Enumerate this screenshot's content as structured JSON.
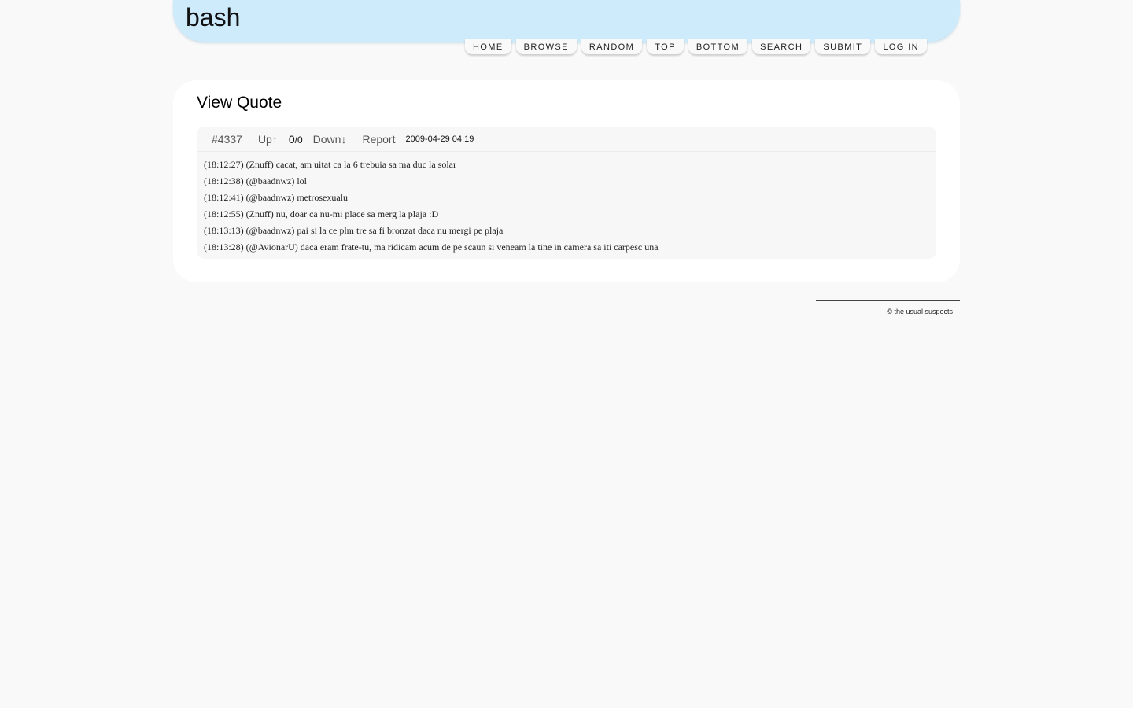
{
  "site": {
    "title": "bash"
  },
  "nav": [
    {
      "label": "Home"
    },
    {
      "label": "Browse"
    },
    {
      "label": "Random"
    },
    {
      "label": "Top"
    },
    {
      "label": "Bottom"
    },
    {
      "label": "Search"
    },
    {
      "label": "Submit"
    },
    {
      "label": "Log In"
    }
  ],
  "page": {
    "title": "View Quote"
  },
  "quote": {
    "id": "#4337",
    "up_label": "Up↑",
    "score": "0",
    "total": "/0",
    "down_label": "Down↓",
    "report_label": "Report",
    "date": "2009-04-29 04:19",
    "lines": [
      "(18:12:27) (Znuff) cacat, am uitat ca la 6 trebuia sa ma duc la solar",
      "(18:12:38) (@baadnwz) lol",
      "(18:12:41) (@baadnwz) metrosexualu",
      "(18:12:55) (Znuff) nu, doar ca nu-mi place sa merg la plaja :D",
      "(18:13:13) (@baadnwz) pai si la ce plm tre sa fi bronzat daca nu mergi pe plaja",
      "(18:13:28) (@AvionarU) daca eram frate-tu, ma ridicam acum de pe scaun si veneam la tine in camera sa iti carpesc una"
    ]
  },
  "footer": {
    "copyright": "© the usual suspects"
  },
  "colors": {
    "background": "#f9f9f9",
    "header": "#cdebfb",
    "quote_bg": "#f7f7f7"
  }
}
